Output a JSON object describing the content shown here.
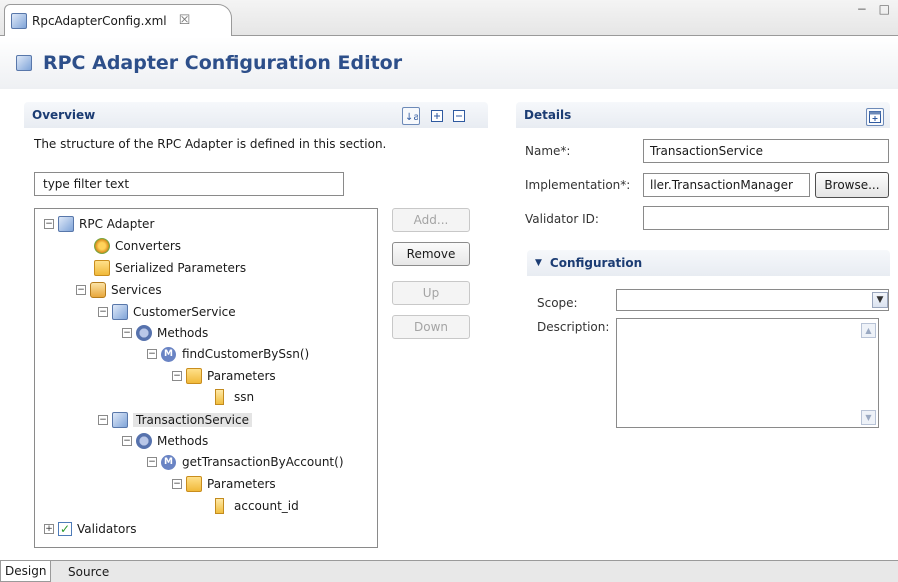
{
  "editor_tab": {
    "label": "RpcAdapterConfig.xml",
    "close_glyph": "☒"
  },
  "window_controls": "− □",
  "editor_title": "RPC Adapter Configuration Editor",
  "overview": {
    "title": "Overview",
    "description": "The structure of the RPC Adapter is defined in this section.",
    "filter_placeholder": "type filter text",
    "tree": [
      {
        "label": "RPC Adapter",
        "icon": "rpc-adapter-icon",
        "toggle": "−"
      },
      {
        "label": "Converters",
        "icon": "converters-icon"
      },
      {
        "label": "Serialized Parameters",
        "icon": "folder-icon"
      },
      {
        "label": "Services",
        "icon": "services-icon",
        "toggle": "−"
      },
      {
        "label": "CustomerService",
        "icon": "service-icon",
        "toggle": "−"
      },
      {
        "label": "Methods",
        "icon": "methods-icon",
        "toggle": "−"
      },
      {
        "label": "findCustomerBySsn()",
        "icon": "method-icon",
        "toggle": "−"
      },
      {
        "label": "Parameters",
        "icon": "folder-icon",
        "toggle": "−"
      },
      {
        "label": "ssn",
        "icon": "parameter-icon"
      },
      {
        "label": "TransactionService",
        "icon": "service-icon",
        "toggle": "−",
        "selected": true
      },
      {
        "label": "Methods",
        "icon": "methods-icon",
        "toggle": "−"
      },
      {
        "label": "getTransactionByAccount()",
        "icon": "method-icon",
        "toggle": "−"
      },
      {
        "label": "Parameters",
        "icon": "folder-icon",
        "toggle": "−"
      },
      {
        "label": "account_id",
        "icon": "parameter-icon"
      },
      {
        "label": "Validators",
        "icon": "validators-icon",
        "toggle": "+"
      }
    ],
    "buttons": {
      "add": "Add...",
      "remove": "Remove",
      "up": "Up",
      "down": "Down"
    }
  },
  "details": {
    "title": "Details",
    "name_label": "Name*:",
    "name_value": "TransactionService",
    "implementation_label": "Implementation*:",
    "implementation_value": "ller.TransactionManager",
    "browse_label": "Browse...",
    "validator_label": "Validator ID:",
    "validator_value": "",
    "configuration": {
      "title": "Configuration",
      "scope_label": "Scope:",
      "scope_value": "",
      "description_label": "Description:",
      "description_value": ""
    }
  },
  "bottom_tabs": [
    "Design",
    "Source"
  ],
  "colors": {
    "title": "#2d4f8a",
    "section_title": "#1b3c73",
    "selection": "#e4e4e4"
  }
}
